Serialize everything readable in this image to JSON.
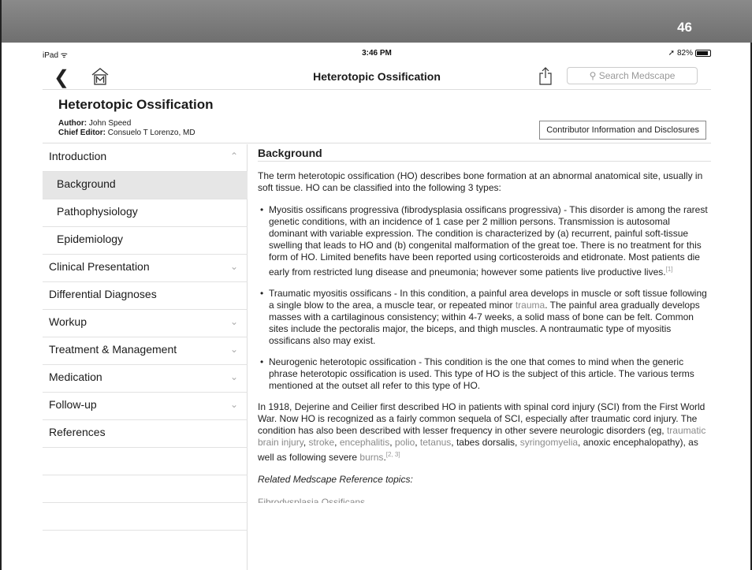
{
  "slide": {
    "page_number": "46"
  },
  "status": {
    "device": "iPad",
    "time": "3:46 PM",
    "battery": "82%"
  },
  "nav": {
    "title": "Heterotopic Ossification",
    "search_placeholder": "Search Medscape"
  },
  "article": {
    "title": "Heterotopic Ossification",
    "author_label": "Author:",
    "author": "John Speed",
    "editor_label": "Chief Editor:",
    "editor": "Consuelo T Lorenzo, MD",
    "contributor_button": "Contributor Information and Disclosures"
  },
  "sidebar": {
    "items": [
      {
        "label": "Introduction"
      },
      {
        "label": "Background"
      },
      {
        "label": "Pathophysiology"
      },
      {
        "label": "Epidemiology"
      },
      {
        "label": "Clinical Presentation"
      },
      {
        "label": "Differential Diagnoses"
      },
      {
        "label": "Workup"
      },
      {
        "label": "Treatment & Management"
      },
      {
        "label": "Medication"
      },
      {
        "label": "Follow-up"
      },
      {
        "label": "References"
      }
    ]
  },
  "content": {
    "section_title": "Background",
    "intro": "The term heterotopic ossification (HO) describes bone formation at an abnormal anatomical site, usually in soft tissue. HO can be classified into the following 3 types:",
    "bullet1": "Myositis ossificans progressiva (fibrodysplasia ossificans progressiva) - This disorder is among the rarest genetic conditions, with an incidence of 1 case per 2 million persons. Transmission is autosomal dominant with variable expression. The condition is characterized by (a) recurrent, painful soft-tissue swelling that leads to HO and (b) congenital malformation of the great toe. There is no treatment for this form of HO. Limited benefits have been reported using corticosteroids and etidronate. Most patients die early from restricted lung disease and pneumonia; however some patients live productive lives.",
    "bullet1_ref": "[1]",
    "bullet2_a": "Traumatic myositis ossificans - In this condition, a painful area develops in muscle or soft tissue following a single blow to the area, a muscle tear, or repeated minor ",
    "bullet2_link": "trauma",
    "bullet2_b": ". The painful area gradually develops masses with a cartilaginous consistency; within 4-7 weeks, a solid mass of bone can be felt. Common sites include the pectoralis major, the biceps, and thigh muscles. A nontraumatic type of myositis ossificans also may exist.",
    "bullet3": "Neurogenic heterotopic ossification - This condition is the one that comes to mind when the generic phrase heterotopic ossification is used. This type of HO is the subject of this article. The various terms mentioned at the outset all refer to this type of HO.",
    "p2_a": "In 1918, Dejerine and Ceilier first described HO in patients with spinal cord injury (SCI) from the First World War. Now HO is recognized as a fairly common sequela of SCI, especially after traumatic cord injury. The condition has also been described with lesser frequency in other severe neurologic disorders (eg, ",
    "l_tbi": "traumatic brain injury",
    "l_stroke": "stroke",
    "l_enceph": "encephalitis",
    "l_polio": "polio",
    "l_tetanus": "tetanus",
    "p2_tabes": "tabes dorsalis",
    "l_syring": "syringomyelia",
    "p2_b": ", anoxic encephalopathy), as well as following severe ",
    "l_burns": "burns",
    "p2_ref": "[2, 3]",
    "related": "Related Medscape Reference topics:",
    "cutoff": "Fibrodysplasia Ossificans"
  }
}
